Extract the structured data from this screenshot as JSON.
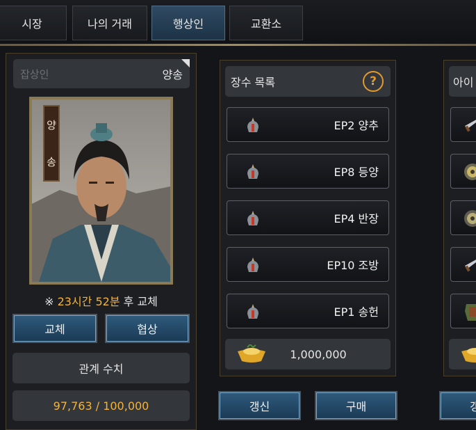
{
  "tabs": [
    {
      "label": "시장",
      "active": false
    },
    {
      "label": "나의 거래",
      "active": false
    },
    {
      "label": "행상인",
      "active": true
    },
    {
      "label": "교환소",
      "active": false
    }
  ],
  "merchant": {
    "type_placeholder": "잡상인",
    "name": "양송",
    "portrait_name_chars": [
      "양",
      "송"
    ],
    "timer_prefix": "※ ",
    "timer_value": "23시간 52분",
    "timer_suffix": " 후 교체",
    "swap_label": "교체",
    "negotiate_label": "협상",
    "relation_label": "관계 수치",
    "relation_value": "97,763 / 100,000"
  },
  "general_list": {
    "title": "장수 목록",
    "help_glyph": "?",
    "items": [
      {
        "label": "EP2 양추",
        "icon": "helmet-icon"
      },
      {
        "label": "EP8 등양",
        "icon": "helmet-icon"
      },
      {
        "label": "EP4 반장",
        "icon": "helmet-icon"
      },
      {
        "label": "EP10 조방",
        "icon": "helmet-icon"
      },
      {
        "label": "EP1 송헌",
        "icon": "helmet-icon"
      }
    ],
    "price": "1,000,000",
    "price_icon": "gold-ingot-icon",
    "refresh_label": "갱신",
    "buy_label": "구매"
  },
  "item_list": {
    "title": "아이",
    "icons": [
      "sword-icon",
      "round-shield-icon",
      "round-shield-icon",
      "sword-icon",
      "armor-icon"
    ],
    "refresh_label_partial": "갱"
  },
  "colors": {
    "accent_gold": "#f2b43c",
    "active_tab": "#2f4a63",
    "button_blue": "#1f4563"
  }
}
